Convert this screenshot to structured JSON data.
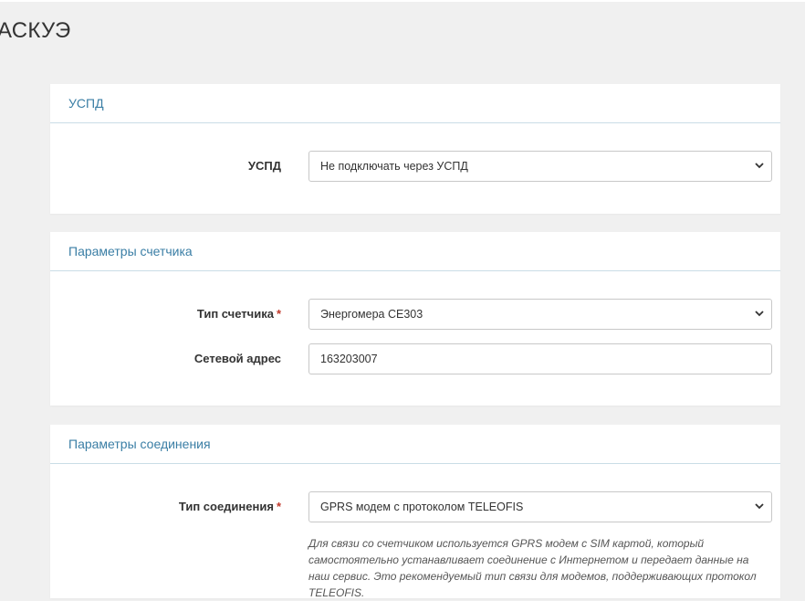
{
  "page": {
    "title": "АСКУЭ"
  },
  "uspd_panel": {
    "title": "УСПД",
    "field_label": "УСПД",
    "select_value": "Не подключать через УСПД"
  },
  "meter_panel": {
    "title": "Параметры счетчика",
    "type_label": "Тип счетчика",
    "type_value": "Энергомера СЕ303",
    "address_label": "Сетевой адрес",
    "address_value": "163203007"
  },
  "connection_panel": {
    "title": "Параметры соединения",
    "type_label": "Тип соединения",
    "type_value": "GPRS модем с протоколом TELEOFIS",
    "help_text": "Для связи со счетчиком используется GPRS модем с SIM картой, который самостоятельно устанавливает соединение с Интернетом и передает данные на наш сервис. Это рекомендуемый тип связи для модемов, поддерживающих протокол TELEOFIS."
  },
  "required_marker": "*",
  "icons": {
    "dropdown": "chevron-down-icon"
  },
  "colors": {
    "panel_title": "#3a7ea5",
    "required": "#c0392b"
  }
}
